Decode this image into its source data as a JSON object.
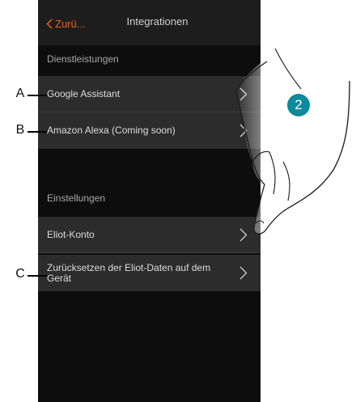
{
  "nav": {
    "back_label": "Zurü...",
    "title": "Integrationen"
  },
  "sections": {
    "services": "Dienstleistungen",
    "settings": "Einstellungen"
  },
  "rows": {
    "google": "Google Assistant",
    "alexa": "Amazon Alexa (Coming soon)",
    "eliot_account": "Eliot-Konto",
    "reset": "Zurücksetzen der Eliot-Daten auf dem Gerät"
  },
  "annotations": {
    "a": "A",
    "b": "B",
    "c": "C",
    "step": "2"
  },
  "colors": {
    "accent": "#e8611a",
    "badge": "#0d8a9c",
    "row_bg": "#2c2c2c",
    "screen_bg": "#0d0d0d"
  },
  "icons": {
    "back": "chevron-left-icon",
    "row": "chevron-right-icon",
    "hand": "pointing-hand-icon"
  }
}
